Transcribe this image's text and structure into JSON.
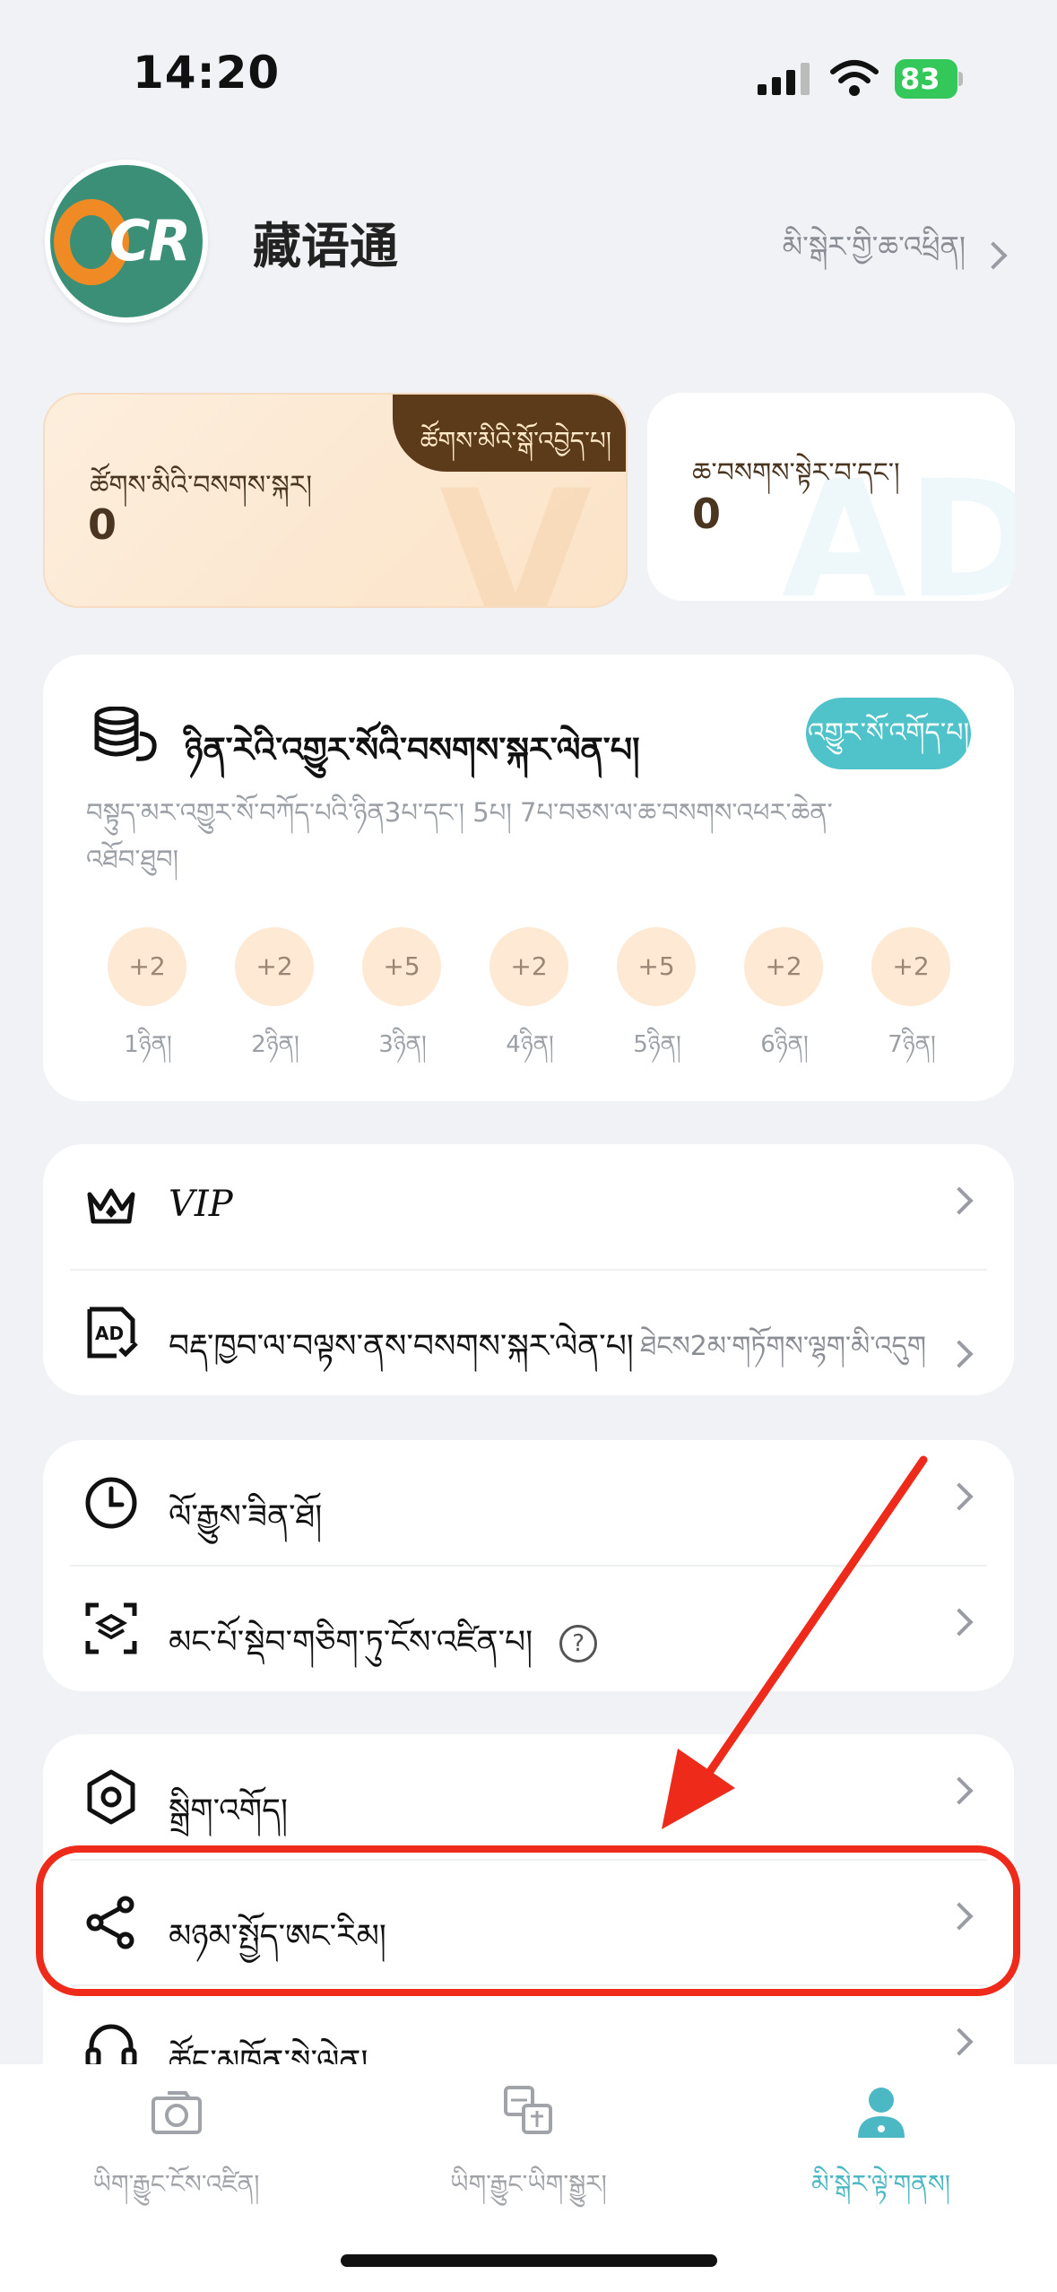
{
  "status_bar": {
    "time": "14:20",
    "battery": "83"
  },
  "profile": {
    "avatar_text_o": "O",
    "avatar_text_cr": "CR",
    "app_name": "藏语通",
    "login_label": "མི་སྒེར་གྱི་ཆ་འཕྲིན།"
  },
  "cards": {
    "points": {
      "badge": "ཚོགས་མིའི་སྒོ་འབྱེད་པ།",
      "label": "ཚོགས་མིའི་བསགས་སྐར།",
      "value": "0"
    },
    "ads": {
      "label": "ཆ་བསགས་སྟེར་བ་དང་།",
      "value": "0"
    }
  },
  "checkin": {
    "title": "ཉིན་རེའི་འགྱུར་སོའི་བསགས་སྐར་ལེན་པ།",
    "button": "འགྱུར་སོ་འགོད་པ།",
    "description": "བསྟུད་མར་འགྱུར་སོ་བཀོད་པའི་ཉིན3པ་དང་། 5པ། 7པ་བཅས་ལ་ཆ་བསགས་འཕར་ཆེན་འཐོབ་ཐུབ།",
    "days": [
      {
        "reward": "+2",
        "label": "1ཉིན།"
      },
      {
        "reward": "+2",
        "label": "2ཉིན།"
      },
      {
        "reward": "+5",
        "label": "3ཉིན།"
      },
      {
        "reward": "+2",
        "label": "4ཉིན།"
      },
      {
        "reward": "+5",
        "label": "5ཉིན།"
      },
      {
        "reward": "+2",
        "label": "6ཉིན།"
      },
      {
        "reward": "+2",
        "label": "7ཉིན།"
      }
    ]
  },
  "menu_group_1": {
    "vip": "VIP",
    "ad_reward": "བརྡ་ཁྱབ་ལ་བལྟས་ནས་བསགས་སྐར་ལེན་པ།",
    "ad_reward_note": "ཐེངས2མ་གཏོགས་ལྷག་མི་འདུག"
  },
  "menu_group_2": {
    "history": "ལོ་རྒྱུས་ཟིན་ཐོ།",
    "multi_scan": "མང་པོ་སྡེབ་གཅིག་ཏུ་ངོས་འཛིན་པ།",
    "help": "?"
  },
  "menu_group_3": {
    "settings": "སྒྲིག་འགོད།",
    "share": "མཉམ་སྤྱོད་ཨང་རིམ།",
    "support": "ཚོང་མཁོན་སྟེ་ལེན།"
  },
  "tabs": [
    {
      "label": "ཡིག་རྒྱུང་ངོས་འཛིན།"
    },
    {
      "label": "ཡིག་རྒྱུང་ཡིག་སྒྱུར།"
    },
    {
      "label": "མི་སྒེར་ལྟེ་གནས།"
    }
  ],
  "colors": {
    "accent": "#4fc3c9",
    "highlight": "#ee2a1b",
    "brown": "#5c3b1a"
  }
}
